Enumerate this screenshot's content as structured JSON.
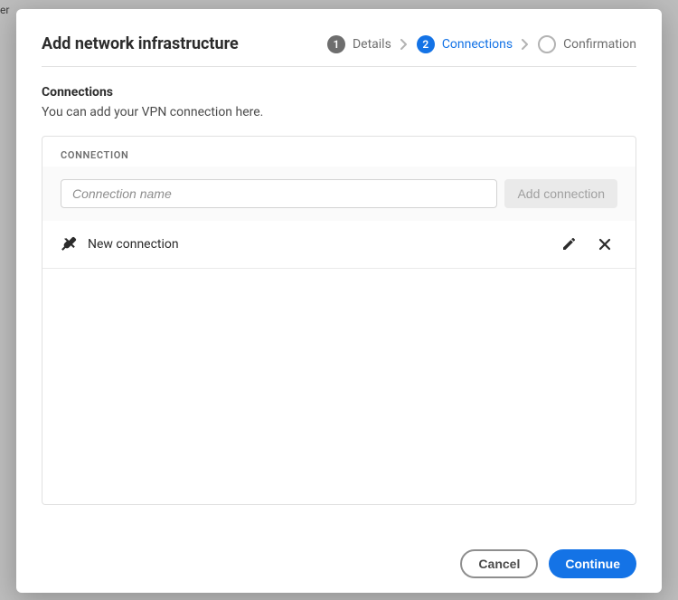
{
  "background_text": "er",
  "dialog": {
    "title": "Add network infrastructure",
    "stepper": {
      "step1": {
        "num": "1",
        "label": "Details"
      },
      "step2": {
        "num": "2",
        "label": "Connections"
      },
      "step3": {
        "num": "",
        "label": "Confirmation"
      }
    },
    "section": {
      "title": "Connections",
      "subtitle": "You can add your VPN connection here."
    },
    "panel": {
      "header": "CONNECTION",
      "input_placeholder": "Connection name",
      "add_button": "Add connection",
      "items": [
        {
          "name": "New connection"
        }
      ]
    },
    "footer": {
      "cancel": "Cancel",
      "continue": "Continue"
    }
  }
}
